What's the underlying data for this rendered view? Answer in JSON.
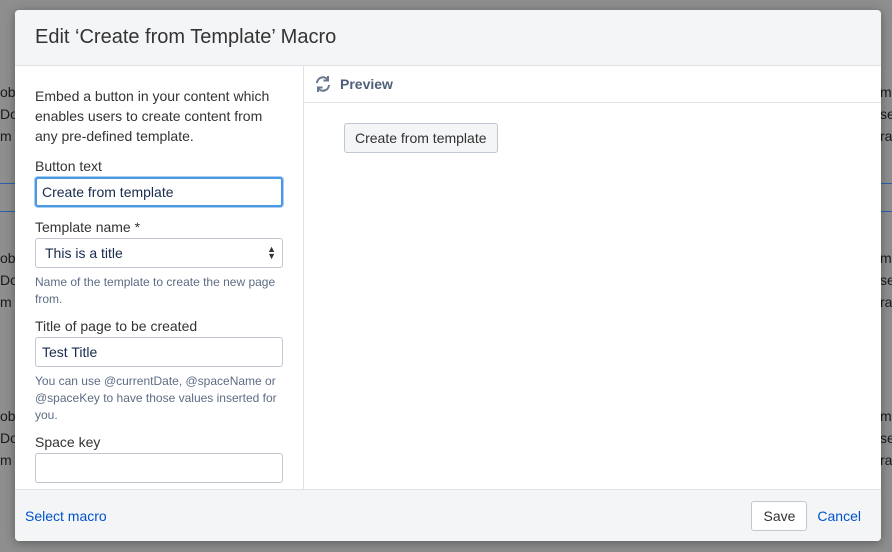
{
  "background": {
    "left_fragments": [
      "ob",
      "Do",
      "m",
      "ob",
      "Do",
      "m",
      "ob",
      "Do",
      "m"
    ],
    "right_fragments": [
      "m",
      "se",
      "ra.",
      "m",
      "se",
      "ra.",
      "m",
      "se",
      "ra."
    ]
  },
  "dialog": {
    "title": "Edit ‘Create from Template’ Macro"
  },
  "form": {
    "description": "Embed a button in your content which enables users to create content from any pre-defined template.",
    "button_text": {
      "label": "Button text",
      "value": "Create from template"
    },
    "template_name": {
      "label": "Template name *",
      "selected": "This is a title",
      "help": "Name of the template to create the new page from."
    },
    "page_title": {
      "label": "Title of page to be created",
      "value": "Test Title",
      "help": "You can use @currentDate, @spaceName or @spaceKey to have those values inserted for you."
    },
    "space_key": {
      "label": "Space key",
      "value": ""
    }
  },
  "preview": {
    "label": "Preview",
    "button_label": "Create from template"
  },
  "footer": {
    "select_macro": "Select macro",
    "save": "Save",
    "cancel": "Cancel"
  },
  "colors": {
    "link": "#0052cc",
    "focus_ring": "#4a9ae1",
    "overlay": "#8e8e8e"
  },
  "icons": {
    "refresh": "refresh-icon",
    "select_arrows": "select-arrows-icon"
  }
}
